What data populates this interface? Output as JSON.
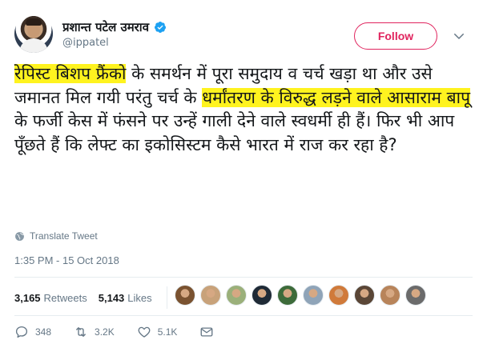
{
  "author": {
    "display_name": "प्रशान्त पटेल उमराव",
    "handle": "@ippatel",
    "verified": true
  },
  "follow_label": "Follow",
  "tweet": {
    "segments": [
      {
        "text": "रेपिस्ट बिशप फ्रैंको",
        "highlight": true
      },
      {
        "text": " के समर्थन में पूरा समुदाय व चर्च खड़ा था और उसे जमानत मिल गयी परंतु चर्च के ",
        "highlight": false
      },
      {
        "text": "धर्मांतरण के विरुद्ध लड़ने वाले आसाराम बापू",
        "highlight": true
      },
      {
        "text": " के फर्जी केस में फंसने पर उन्हें गाली देने वाले स्वधर्मी ही हैं। फिर भी आप पूँछते हैं कि लेफ्ट का इकोसिस्टम कैसे भारत में राज कर रहा है?",
        "highlight": false
      }
    ]
  },
  "translate_label": "Translate Tweet",
  "timestamp": "1:35 PM - 15 Oct 2018",
  "stats": {
    "retweets_count": "3,165",
    "retweets_label": "Retweets",
    "likes_count": "5,143",
    "likes_label": "Likes"
  },
  "liker_avatar_colors": [
    "#7a5230",
    "#c8a27a",
    "#9bb07a",
    "#1f2a36",
    "#3d6b3a",
    "#8fa4b8",
    "#d07a3a",
    "#5a4636",
    "#b8845a",
    "#6b6b6b"
  ],
  "actions": {
    "reply_count": "348",
    "retweet_count": "3.2K",
    "like_count": "5.1K"
  },
  "colors": {
    "follow_accent": "#e0245e",
    "verified_blue": "#1da1f2",
    "highlight": "#fff31f",
    "muted": "#657786"
  }
}
